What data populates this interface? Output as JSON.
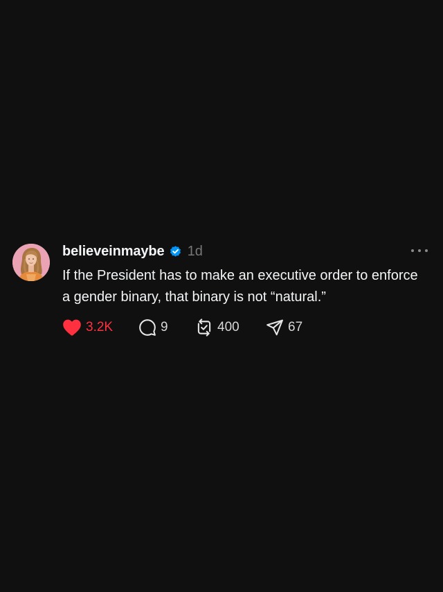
{
  "post": {
    "username": "believeinmaybe",
    "timestamp": "1d",
    "text": "If the President has to make an executive order to enforce a gender binary, that binary is not “natural.”"
  },
  "actions": {
    "likes": "3.2K",
    "replies": "9",
    "reposts": "400",
    "shares": "67"
  },
  "icons": {
    "avatar": "avatar",
    "verified": "verified-badge-icon",
    "more": "more-options-icon",
    "like": "heart-icon",
    "reply": "comment-icon",
    "repost": "repost-icon",
    "share": "share-icon"
  },
  "colors": {
    "background": "#101010",
    "text": "#f3f5f7",
    "muted": "#777777",
    "like_active": "#ff3040",
    "verified": "#0095f6"
  }
}
